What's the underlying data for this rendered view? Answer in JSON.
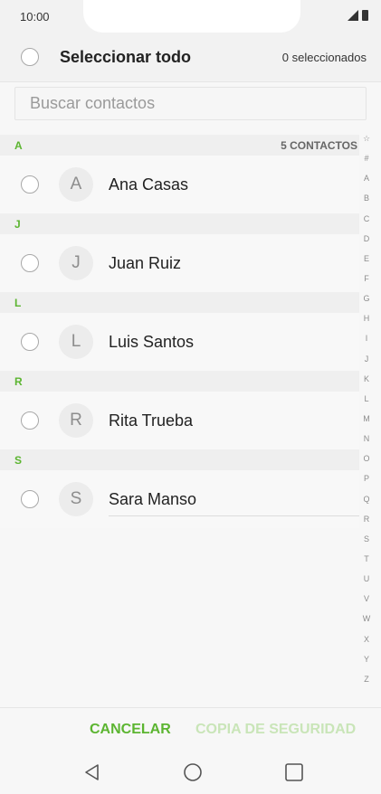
{
  "status_bar": {
    "time": "10:00"
  },
  "header": {
    "select_all_label": "Seleccionar todo",
    "selected_count": "0 seleccionados"
  },
  "search": {
    "placeholder": "Buscar contactos"
  },
  "contact_count": "5 CONTACTOS",
  "sections": [
    {
      "letter": "A",
      "contact": {
        "initial": "A",
        "name": "Ana Casas"
      }
    },
    {
      "letter": "J",
      "contact": {
        "initial": "J",
        "name": "Juan Ruiz"
      }
    },
    {
      "letter": "L",
      "contact": {
        "initial": "L",
        "name": "Luis Santos"
      }
    },
    {
      "letter": "R",
      "contact": {
        "initial": "R",
        "name": "Rita Trueba"
      }
    },
    {
      "letter": "S",
      "contact": {
        "initial": "S",
        "name": "Sara Manso"
      }
    }
  ],
  "alphabet_index": [
    "☆",
    "#",
    "A",
    "B",
    "C",
    "D",
    "E",
    "F",
    "G",
    "H",
    "I",
    "J",
    "K",
    "L",
    "M",
    "N",
    "O",
    "P",
    "Q",
    "R",
    "S",
    "T",
    "U",
    "V",
    "W",
    "X",
    "Y",
    "Z"
  ],
  "actions": {
    "cancel": "CANCELAR",
    "backup": "COPIA DE SEGURIDAD"
  },
  "colors": {
    "accent": "#5cb531",
    "accent_disabled": "#c9e5b8"
  },
  "nav_icons": [
    "back-icon",
    "home-icon",
    "recent-apps-icon"
  ]
}
